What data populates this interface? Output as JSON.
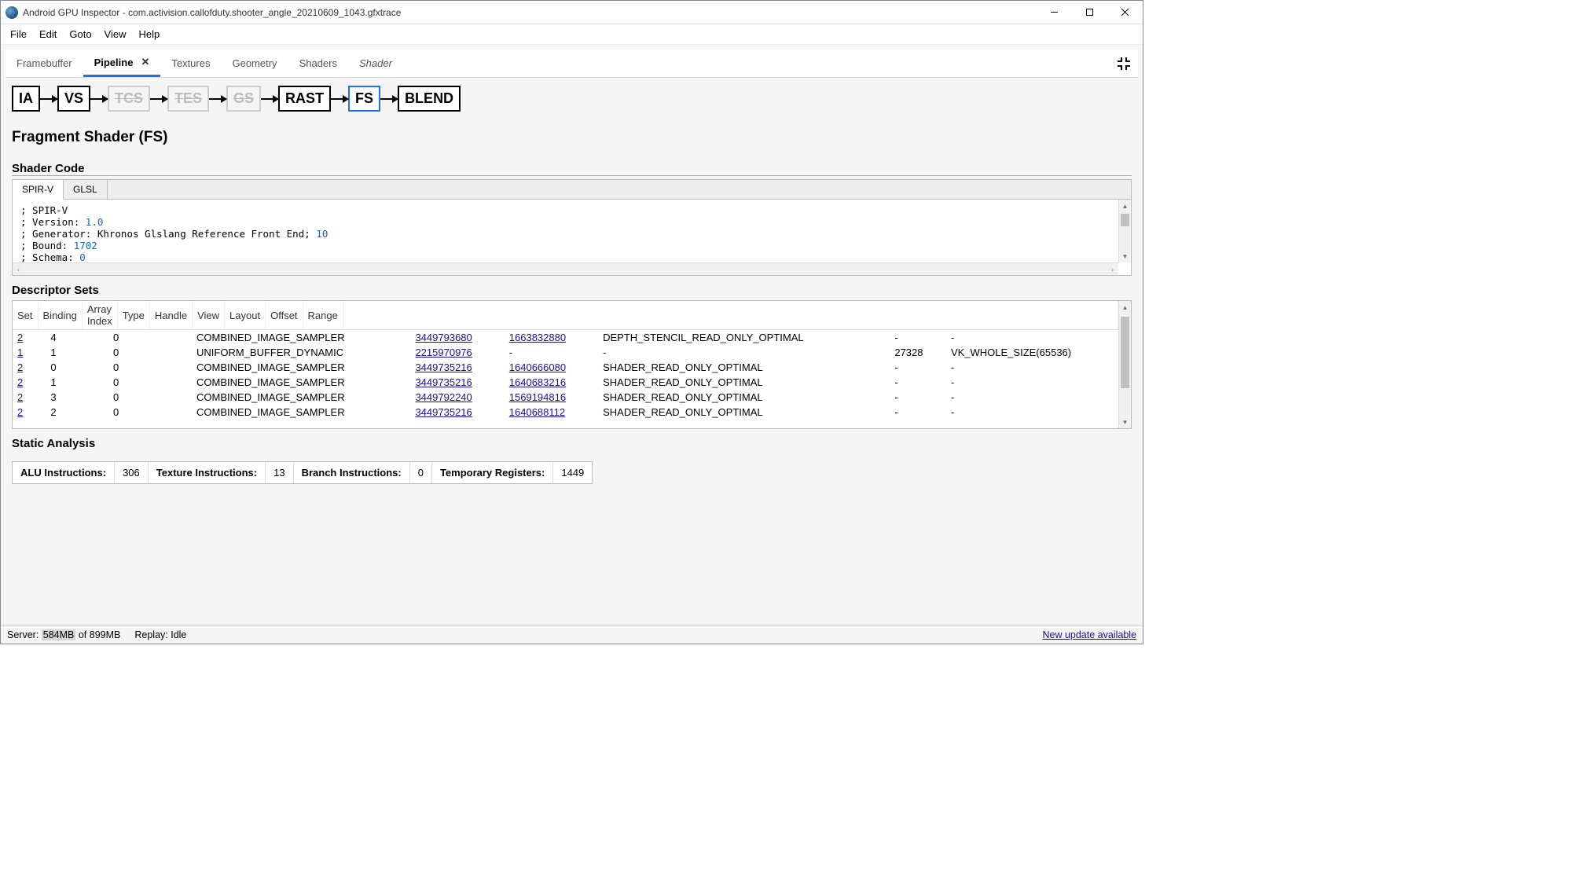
{
  "titlebar": {
    "title": "Android GPU Inspector - com.activision.callofduty.shooter_angle_20210609_1043.gfxtrace"
  },
  "menubar": {
    "items": [
      "File",
      "Edit",
      "Goto",
      "View",
      "Help"
    ]
  },
  "tabs": {
    "items": [
      {
        "label": "Framebuffer",
        "active": false
      },
      {
        "label": "Pipeline",
        "active": true,
        "closeable": true
      },
      {
        "label": "Textures",
        "active": false
      },
      {
        "label": "Geometry",
        "active": false
      },
      {
        "label": "Shaders",
        "active": false
      },
      {
        "label": "Shader",
        "active": false,
        "italic": true
      }
    ]
  },
  "pipeline": {
    "stages": [
      {
        "label": "IA",
        "enabled": true
      },
      {
        "label": "VS",
        "enabled": true
      },
      {
        "label": "TCS",
        "enabled": false
      },
      {
        "label": "TES",
        "enabled": false
      },
      {
        "label": "GS",
        "enabled": false
      },
      {
        "label": "RAST",
        "enabled": true
      },
      {
        "label": "FS",
        "enabled": true,
        "selected": true
      },
      {
        "label": "BLEND",
        "enabled": true
      }
    ]
  },
  "fragment_section": {
    "heading": "Fragment Shader (FS)"
  },
  "shader_code": {
    "heading": "Shader Code",
    "tabs": [
      "SPIR-V",
      "GLSL"
    ],
    "active_tab": 0,
    "lines": [
      {
        "prefix": "; SPIR-V",
        "num": ""
      },
      {
        "prefix": "; Version: ",
        "num": "1.0"
      },
      {
        "prefix": "; Generator: Khronos Glslang Reference Front End; ",
        "num": "10"
      },
      {
        "prefix": "; Bound: ",
        "num": "1702"
      },
      {
        "prefix": "; Schema: ",
        "num": "0"
      }
    ]
  },
  "descriptor_sets": {
    "heading": "Descriptor Sets",
    "columns": [
      "Set",
      "Binding",
      "Array Index",
      "Type",
      "Handle",
      "View",
      "Layout",
      "Offset",
      "Range"
    ],
    "rows": [
      {
        "set": "2",
        "binding": "4",
        "array_index": "0",
        "type": "COMBINED_IMAGE_SAMPLER",
        "handle": "3449793680",
        "view": "1663832880",
        "layout": "DEPTH_STENCIL_READ_ONLY_OPTIMAL",
        "offset": "-",
        "range": "-"
      },
      {
        "set": "1",
        "binding": "1",
        "array_index": "0",
        "type": "UNIFORM_BUFFER_DYNAMIC",
        "handle": "2215970976",
        "view": "-",
        "layout": "-",
        "offset": "27328",
        "range": "VK_WHOLE_SIZE(65536)"
      },
      {
        "set": "2",
        "binding": "0",
        "array_index": "0",
        "type": "COMBINED_IMAGE_SAMPLER",
        "handle": "3449735216",
        "view": "1640666080",
        "layout": "SHADER_READ_ONLY_OPTIMAL",
        "offset": "-",
        "range": "-"
      },
      {
        "set": "2",
        "binding": "1",
        "array_index": "0",
        "type": "COMBINED_IMAGE_SAMPLER",
        "handle": "3449735216",
        "view": "1640683216",
        "layout": "SHADER_READ_ONLY_OPTIMAL",
        "offset": "-",
        "range": "-"
      },
      {
        "set": "2",
        "binding": "3",
        "array_index": "0",
        "type": "COMBINED_IMAGE_SAMPLER",
        "handle": "3449792240",
        "view": "1569194816",
        "layout": "SHADER_READ_ONLY_OPTIMAL",
        "offset": "-",
        "range": "-"
      },
      {
        "set": "2",
        "binding": "2",
        "array_index": "0",
        "type": "COMBINED_IMAGE_SAMPLER",
        "handle": "3449735216",
        "view": "1640688112",
        "layout": "SHADER_READ_ONLY_OPTIMAL",
        "offset": "-",
        "range": "-"
      }
    ]
  },
  "static_analysis": {
    "heading": "Static Analysis",
    "metrics": [
      {
        "label": "ALU Instructions:",
        "value": "306"
      },
      {
        "label": "Texture Instructions:",
        "value": "13"
      },
      {
        "label": "Branch Instructions:",
        "value": "0"
      },
      {
        "label": "Temporary Registers:",
        "value": "1449"
      }
    ]
  },
  "statusbar": {
    "server_prefix": "Server: ",
    "server_used": "584MB",
    "server_total": " of 899MB",
    "replay": "Replay:  Idle",
    "update": "New update available"
  }
}
